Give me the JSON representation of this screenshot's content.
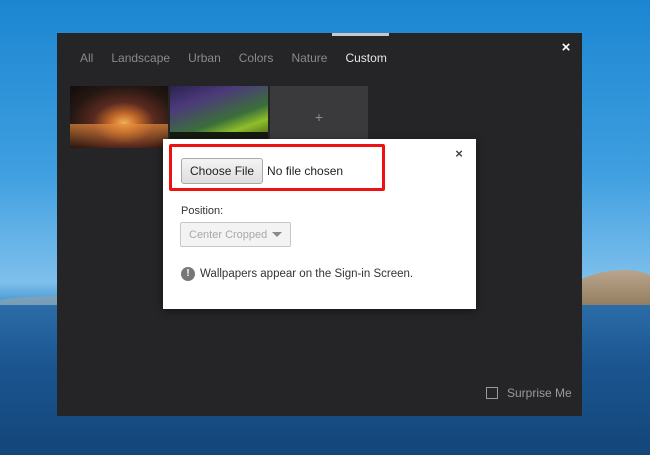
{
  "picker": {
    "close_glyph": "×",
    "tabs": [
      {
        "label": "All",
        "active": false
      },
      {
        "label": "Landscape",
        "active": false
      },
      {
        "label": "Urban",
        "active": false
      },
      {
        "label": "Colors",
        "active": false
      },
      {
        "label": "Nature",
        "active": false
      },
      {
        "label": "Custom",
        "active": true
      }
    ],
    "add_glyph": "+",
    "surprise_label": "Surprise Me",
    "surprise_checked": false
  },
  "dialog": {
    "close_glyph": "×",
    "choose_file_label": "Choose File",
    "no_file_text": "No file chosen",
    "position_label": "Position:",
    "position_value": "Center Cropped",
    "info_glyph": "!",
    "info_text": "Wallpapers appear on the Sign-in Screen.",
    "highlight_color": "#ee1111"
  }
}
